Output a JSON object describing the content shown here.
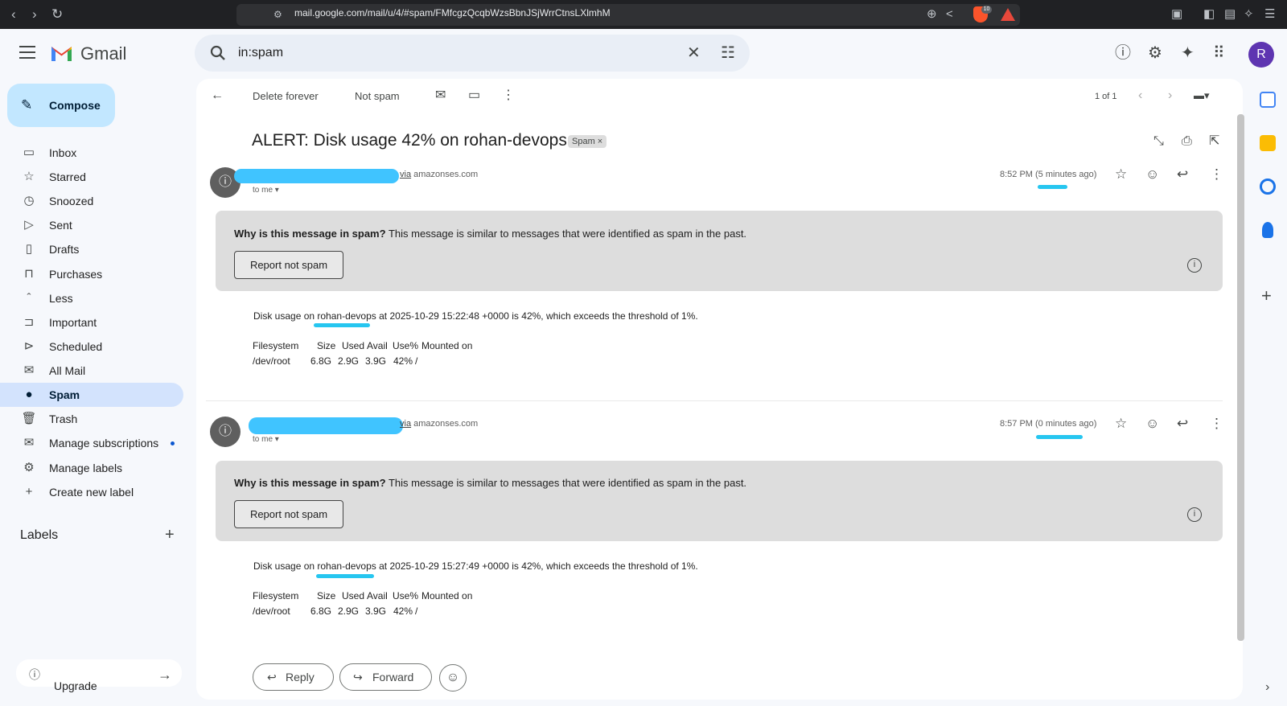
{
  "browser": {
    "url": "mail.google.com/mail/u/4/#spam/FMfcgzQcqbWzsBbnJSjWrrCtnsLXlmhM",
    "brave_badge": "10"
  },
  "gmail": {
    "app_name": "Gmail",
    "search_value": "in:spam",
    "avatar_initial": "R"
  },
  "sidebar": {
    "compose": "Compose",
    "items": [
      {
        "label": "Inbox",
        "icon": "inbox-icon"
      },
      {
        "label": "Starred",
        "icon": "star-icon"
      },
      {
        "label": "Snoozed",
        "icon": "clock-icon"
      },
      {
        "label": "Sent",
        "icon": "send-icon"
      },
      {
        "label": "Drafts",
        "icon": "draft-icon"
      },
      {
        "label": "Purchases",
        "icon": "bag-icon"
      },
      {
        "label": "Less",
        "icon": "chevron-up-icon"
      },
      {
        "label": "Important",
        "icon": "important-icon"
      },
      {
        "label": "Scheduled",
        "icon": "scheduled-icon"
      },
      {
        "label": "All Mail",
        "icon": "all-mail-icon"
      },
      {
        "label": "Spam",
        "icon": "spam-icon"
      },
      {
        "label": "Trash",
        "icon": "trash-icon"
      },
      {
        "label": "Manage subscriptions",
        "icon": "subscriptions-icon"
      },
      {
        "label": "Manage labels",
        "icon": "gear-icon"
      },
      {
        "label": "Create new label",
        "icon": "plus-icon"
      }
    ],
    "labels_heading": "Labels",
    "upgrade": "Upgrade"
  },
  "toolbar": {
    "delete_forever": "Delete forever",
    "not_spam": "Not spam",
    "pagination": "1 of 1"
  },
  "thread": {
    "subject": "ALERT: Disk usage 42% on rohan-devops",
    "spam_chip": "Spam ×",
    "messages": [
      {
        "via": "via",
        "domain": "amazonses.com",
        "to": "to me ▾",
        "time": "8:52 PM (5 minutes ago)",
        "warning_bold": "Why is this message in spam?",
        "warning_text": "This message is similar to messages that were identified as spam in the past.",
        "report_button": "Report not spam",
        "body_prefix": "Disk usage on",
        "host": "rohan-devops",
        "body_suffix": "at 2025-10-29 15:22:48 +0000 is 42%, which exceeds the threshold of 1%.",
        "df_header": [
          "Filesystem",
          "Size",
          "Used",
          "Avail",
          "Use%",
          "Mounted on"
        ],
        "df_row": [
          "/dev/root",
          "6.8G",
          "2.9G",
          "3.9G",
          "42%",
          "/"
        ]
      },
      {
        "via": "via",
        "domain": "amazonses.com",
        "to": "to me ▾",
        "time": "8:57 PM (0 minutes ago)",
        "warning_bold": "Why is this message in spam?",
        "warning_text": "This message is similar to messages that were identified as spam in the past.",
        "report_button": "Report not spam",
        "body_prefix": "Disk usage on",
        "host": "rohan-devops",
        "body_suffix": "at 2025-10-29 15:27:49 +0000 is 42%, which exceeds the threshold of 1%.",
        "df_header": [
          "Filesystem",
          "Size",
          "Used",
          "Avail",
          "Use%",
          "Mounted on"
        ],
        "df_row": [
          "/dev/root",
          "6.8G",
          "2.9G",
          "3.9G",
          "42%",
          "/"
        ]
      }
    ],
    "reply": "Reply",
    "forward": "Forward"
  },
  "colors": {
    "accent": "#0b57d0",
    "compose_bg": "#c2e7ff",
    "active_nav": "#d3e3fd",
    "redaction": "#40c4ff"
  }
}
